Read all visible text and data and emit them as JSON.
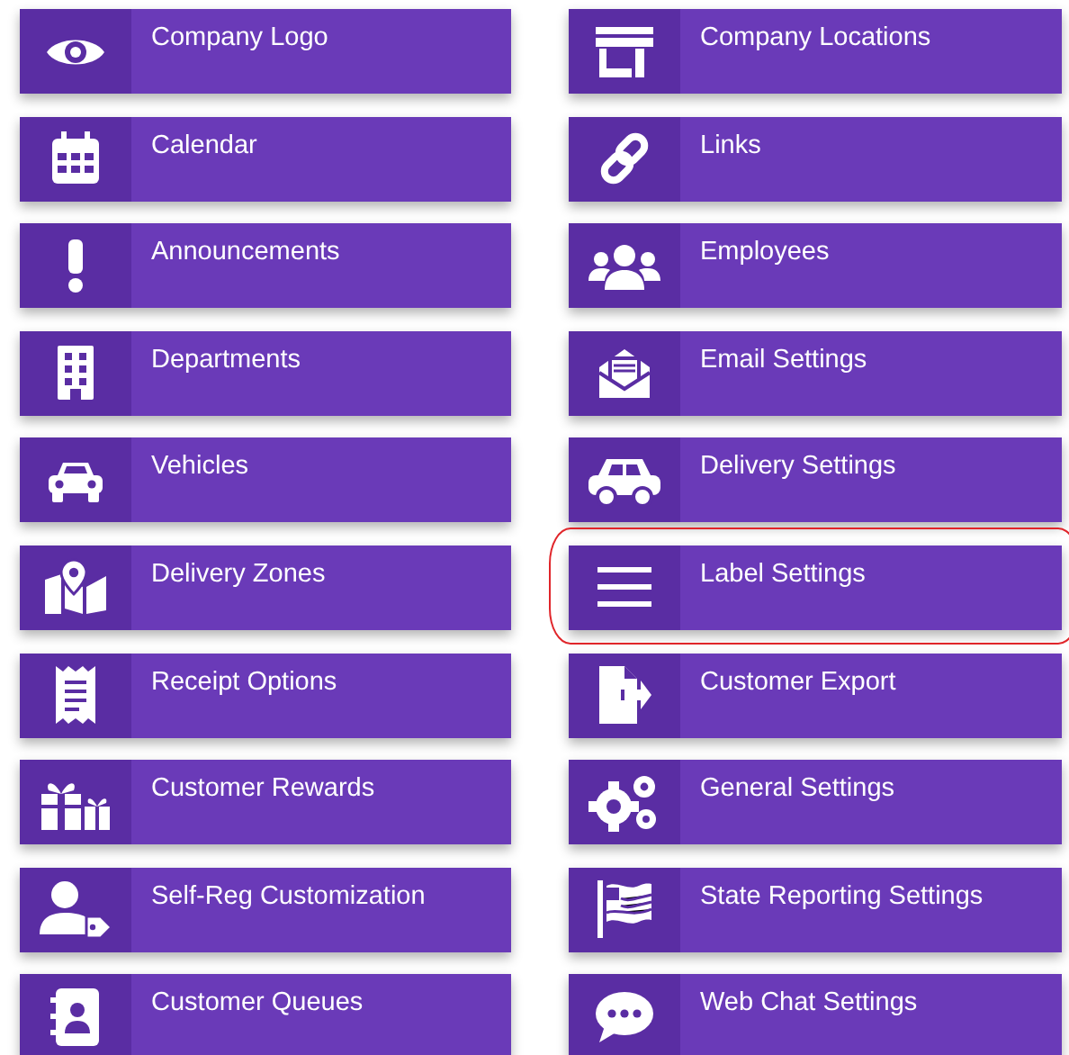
{
  "tiles": [
    {
      "label": "Company Logo",
      "highlighted": false
    },
    {
      "label": "Company Locations",
      "highlighted": false
    },
    {
      "label": "Calendar",
      "highlighted": false
    },
    {
      "label": "Links",
      "highlighted": false
    },
    {
      "label": "Announcements",
      "highlighted": false
    },
    {
      "label": "Employees",
      "highlighted": false
    },
    {
      "label": "Departments",
      "highlighted": false
    },
    {
      "label": "Email Settings",
      "highlighted": false
    },
    {
      "label": "Vehicles",
      "highlighted": false
    },
    {
      "label": "Delivery Settings",
      "highlighted": false
    },
    {
      "label": "Delivery Zones",
      "highlighted": false
    },
    {
      "label": "Label Settings",
      "highlighted": true
    },
    {
      "label": "Receipt Options",
      "highlighted": false
    },
    {
      "label": "Customer Export",
      "highlighted": false
    },
    {
      "label": "Customer Rewards",
      "highlighted": false
    },
    {
      "label": "General Settings",
      "highlighted": false
    },
    {
      "label": "Self-Reg Customization",
      "highlighted": false
    },
    {
      "label": "State Reporting Settings",
      "highlighted": false
    },
    {
      "label": "Customer Queues",
      "highlighted": false
    },
    {
      "label": "Web Chat Settings",
      "highlighted": false
    }
  ]
}
